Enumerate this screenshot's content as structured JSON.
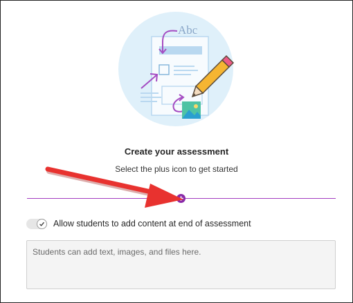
{
  "illustration": {
    "text": "Abc",
    "colors": {
      "circle": "#dff0fa",
      "paper": "#f7fbfe",
      "accent_blue": "#b9d8f0",
      "arrow_purple": "#a44bc2",
      "pencil": "#f5b532",
      "pencil_eraser": "#ec5a86",
      "image_tile": "#4ec3a4"
    }
  },
  "assessment": {
    "title": "Create your assessment",
    "subtitle": "Select the plus icon to get started",
    "divider_color": "#a23bbf",
    "add_button_icon": "plus-icon"
  },
  "annotation": {
    "arrow_color": "#e8322f"
  },
  "settings": {
    "allow_content_label": "Allow students to add content at end of assessment",
    "allow_content_enabled": true,
    "toggle_icon": "check-icon"
  },
  "student_content": {
    "placeholder": "Students can add text, images, and files here."
  }
}
